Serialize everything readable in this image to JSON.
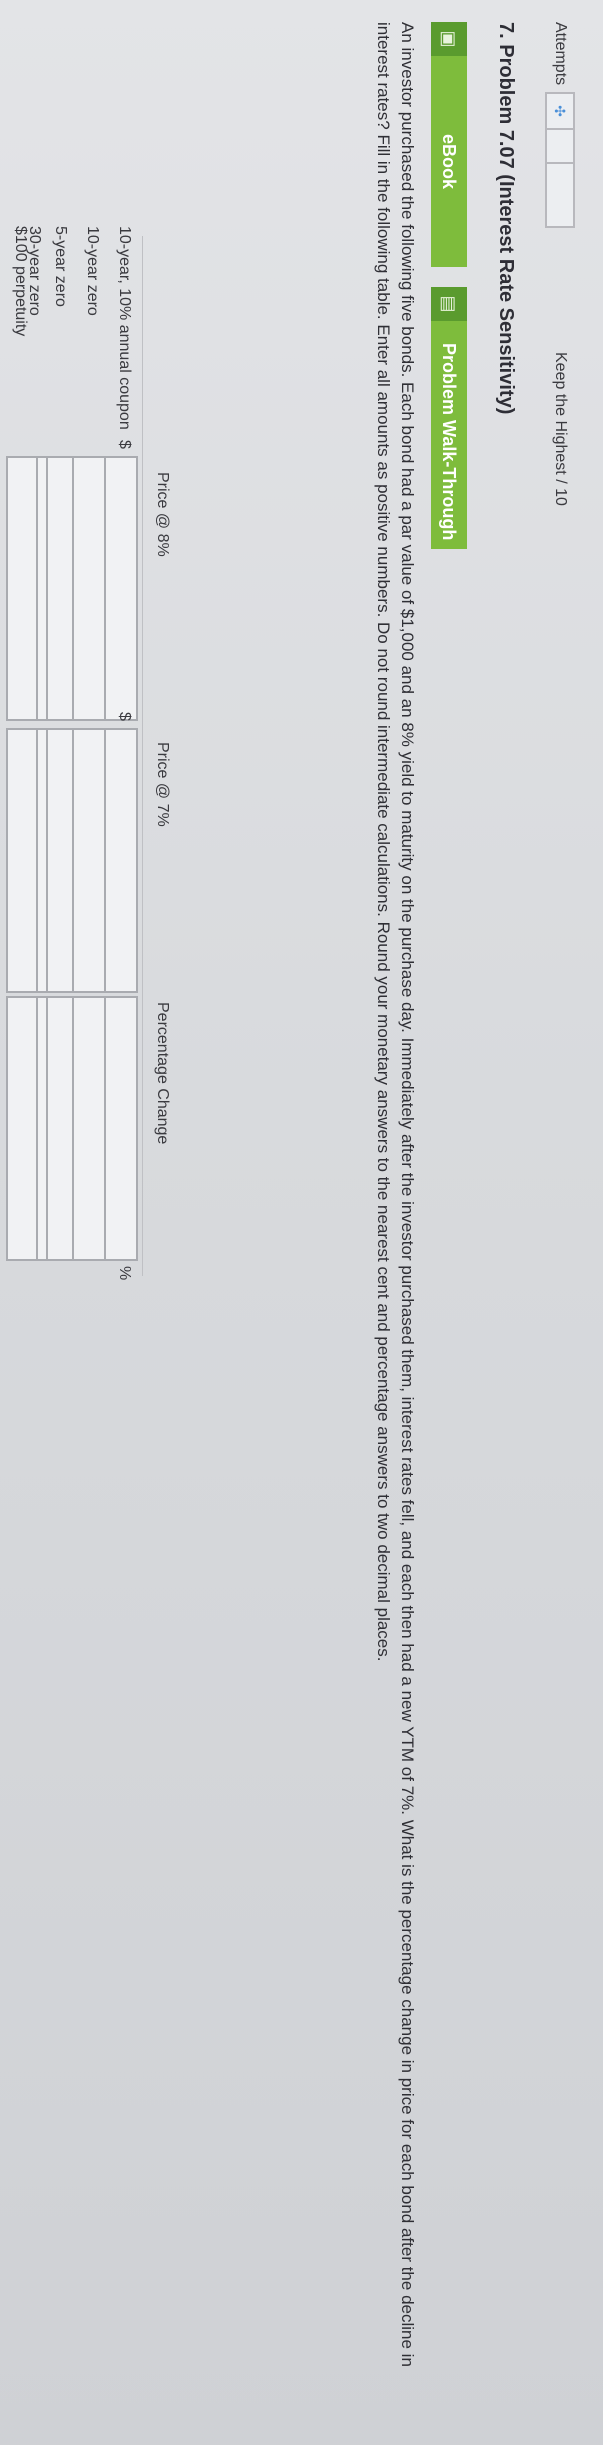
{
  "attempts": {
    "label": "Attempts",
    "spinner_icon": "spinner-icon",
    "keep_text": "Keep the Highest / 10"
  },
  "problem": {
    "title": "7. Problem 7.07 (Interest Rate Sensitivity)"
  },
  "tabs": [
    {
      "label": "eBook",
      "icon": "book-icon"
    },
    {
      "label": "Problem Walk-Through",
      "icon": "video-icon"
    }
  ],
  "description": "An investor purchased the following five bonds. Each bond had a par value of $1,000 and an 8% yield to maturity on the purchase day. Immediately after the investor purchased them, interest rates fell, and each then had a new YTM of 7%. What is the percentage change in price for each bond after the decline in interest rates? Fill in the following table. Enter all amounts as positive numbers. Do not round intermediate calculations. Round your monetary answers to the nearest cent and percentage answers to two decimal places.",
  "table": {
    "headers": [
      "Price @ 8%",
      "Price @ 7%",
      "Percentage Change"
    ],
    "currency_symbol": "$",
    "percent_symbol": "%",
    "rows": [
      {
        "label": "10-year, 10% annual coupon",
        "price8": "",
        "price7": "",
        "change": ""
      },
      {
        "label": "10-year zero",
        "price8": "",
        "price7": "",
        "change": ""
      },
      {
        "label": "5-year zero",
        "price8": "",
        "price7": "",
        "change": ""
      },
      {
        "label": "30-year zero",
        "price8": "",
        "price7": "",
        "change": ""
      },
      {
        "label": "$100 perpetuity",
        "price8": "",
        "price7": "",
        "change": ""
      }
    ]
  },
  "colors": {
    "tab_green": "#7ebc3c",
    "tab_icon_green": "#5a9b2e",
    "accent_blue": "#4a8fd8"
  }
}
